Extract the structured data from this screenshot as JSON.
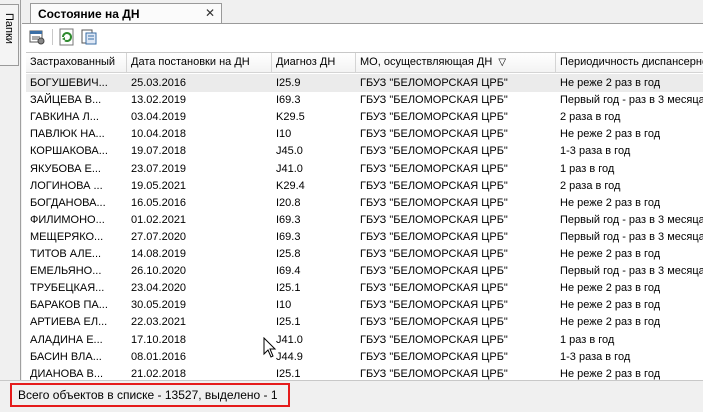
{
  "sidebar": {
    "folders_label": "Папки"
  },
  "tab": {
    "title": "Состояние на ДН",
    "close_glyph": "✕"
  },
  "toolbar": {
    "buttons": [
      {
        "icon": "properties-icon"
      },
      {
        "icon": "refresh-icon"
      },
      {
        "icon": "export-icon"
      }
    ]
  },
  "table": {
    "columns": [
      "Застрахованный",
      "Дата постановки на ДН",
      "Диагноз ДН",
      "МО, осуществляющая ДН",
      "Периодичность диспансерного наблюдения"
    ],
    "sort_glyph": "▽",
    "rows": [
      [
        "БОГУШЕВИЧ...",
        "25.03.2016",
        "I25.9",
        "ГБУЗ \"БЕЛОМОРСКАЯ ЦРБ\"",
        "Не реже 2 раз в год"
      ],
      [
        "ЗАЙЦЕВА В...",
        "13.02.2019",
        "I69.3",
        "ГБУЗ \"БЕЛОМОРСКАЯ ЦРБ\"",
        "Первый год - раз в 3 месяца"
      ],
      [
        "ГАВКИНА Л...",
        "03.04.2019",
        "K29.5",
        "ГБУЗ \"БЕЛОМОРСКАЯ ЦРБ\"",
        "2 раза в год"
      ],
      [
        "ПАВЛЮК НА...",
        "10.04.2018",
        "I10",
        "ГБУЗ \"БЕЛОМОРСКАЯ ЦРБ\"",
        "Не реже 2 раз в год"
      ],
      [
        "КОРШАКОВА...",
        "19.07.2018",
        "J45.0",
        "ГБУЗ \"БЕЛОМОРСКАЯ ЦРБ\"",
        "1-3 раза в год"
      ],
      [
        "ЯКУБОВА Е...",
        "23.07.2019",
        "J41.0",
        "ГБУЗ \"БЕЛОМОРСКАЯ ЦРБ\"",
        "1 раз в год"
      ],
      [
        "ЛОГИНОВА ...",
        "19.05.2021",
        "K29.4",
        "ГБУЗ \"БЕЛОМОРСКАЯ ЦРБ\"",
        "2 раза в год"
      ],
      [
        "БОГДАНОВА...",
        "16.05.2016",
        "I20.8",
        "ГБУЗ \"БЕЛОМОРСКАЯ ЦРБ\"",
        "Не реже 2 раз в год"
      ],
      [
        "ФИЛИМОНО...",
        "01.02.2021",
        "I69.3",
        "ГБУЗ \"БЕЛОМОРСКАЯ ЦРБ\"",
        "Первый год - раз в 3 месяца"
      ],
      [
        "МЕЩЕРЯКО...",
        "27.07.2020",
        "I69.3",
        "ГБУЗ \"БЕЛОМОРСКАЯ ЦРБ\"",
        "Первый год - раз в 3 месяца"
      ],
      [
        "ТИТОВ АЛЕ...",
        "14.08.2019",
        "I25.8",
        "ГБУЗ \"БЕЛОМОРСКАЯ ЦРБ\"",
        "Не реже 2 раз в год"
      ],
      [
        "ЕМЕЛЬЯНО...",
        "26.10.2020",
        "I69.4",
        "ГБУЗ \"БЕЛОМОРСКАЯ ЦРБ\"",
        "Первый год - раз в 3 месяца"
      ],
      [
        "ТРУБЕЦКАЯ...",
        "23.04.2020",
        "I25.1",
        "ГБУЗ \"БЕЛОМОРСКАЯ ЦРБ\"",
        "Не реже 2 раз в год"
      ],
      [
        "БАРАКОВ ПА...",
        "30.05.2019",
        "I10",
        "ГБУЗ \"БЕЛОМОРСКАЯ ЦРБ\"",
        "Не реже 2 раз в год"
      ],
      [
        "АРТИЕВА ЕЛ...",
        "22.03.2021",
        "I25.1",
        "ГБУЗ \"БЕЛОМОРСКАЯ ЦРБ\"",
        "Не реже 2 раз в год"
      ],
      [
        "АЛАДИНА Е...",
        "17.10.2018",
        "J41.0",
        "ГБУЗ \"БЕЛОМОРСКАЯ ЦРБ\"",
        "1 раз в год"
      ],
      [
        "БАСИН ВЛА...",
        "08.01.2016",
        "J44.9",
        "ГБУЗ \"БЕЛОМОРСКАЯ ЦРБ\"",
        "1-3 раза в год"
      ],
      [
        "ДИАНОВА В...",
        "21.02.2018",
        "I25.1",
        "ГБУЗ \"БЕЛОМОРСКАЯ ЦРБ\"",
        "Не реже 2 раз в год"
      ]
    ]
  },
  "status": {
    "text": "Всего объектов в списке - 13527, выделено - 1",
    "highlight_color": "#e51b1b"
  },
  "colors": {
    "selected_row": "#ebebeb"
  }
}
